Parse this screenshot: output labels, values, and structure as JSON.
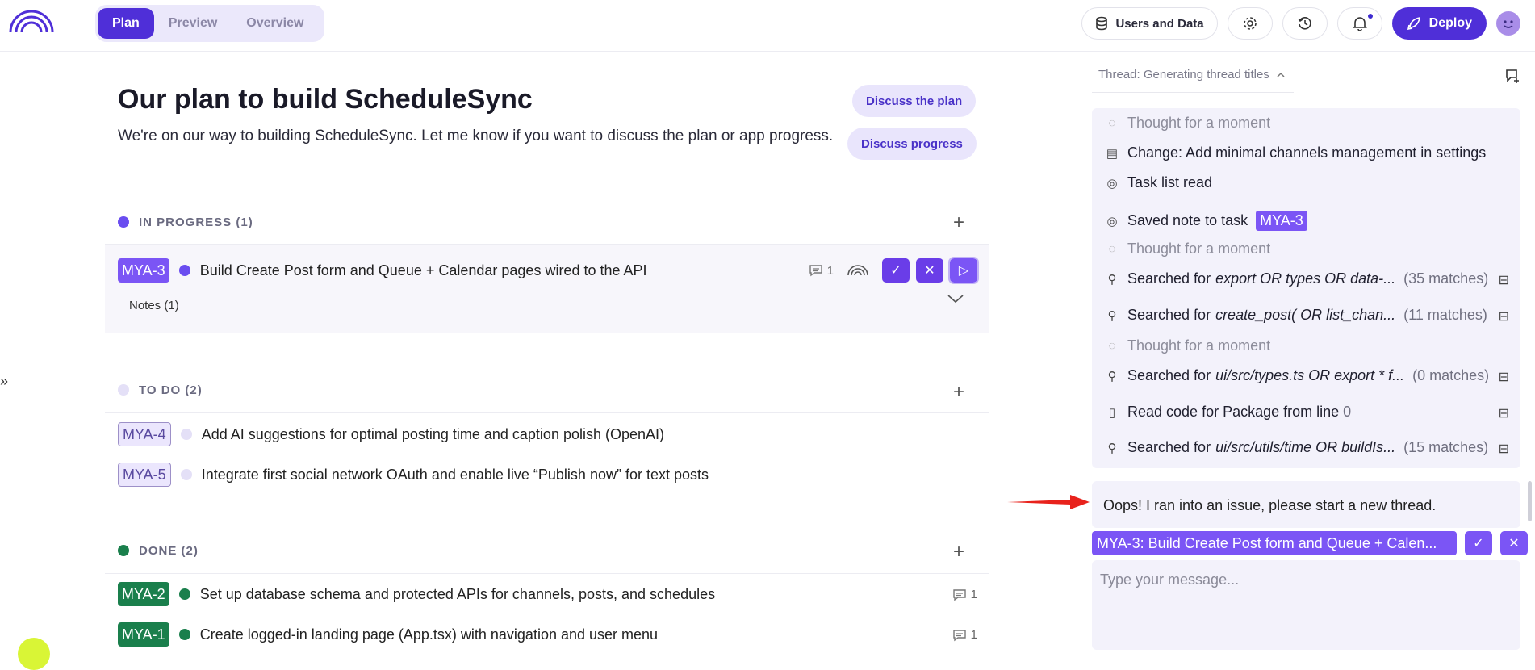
{
  "header": {
    "tabs": [
      {
        "label": "Plan",
        "active": true
      },
      {
        "label": "Preview",
        "active": false
      },
      {
        "label": "Overview",
        "active": false
      }
    ],
    "users_data_label": "Users and Data",
    "deploy_label": "Deploy"
  },
  "plan": {
    "title": "Our plan to build ScheduleSync",
    "subtitle": "We're on our way to building ScheduleSync. Let me know if you want to discuss the plan or app progress.",
    "discuss_plan": "Discuss the plan",
    "discuss_progress": "Discuss progress",
    "sections": {
      "in_progress": {
        "label": "IN PROGRESS (1)",
        "color": "#6a4df0",
        "task": {
          "id": "MYA-3",
          "text": "Build Create Post form and Queue + Calendar pages wired to the API",
          "comments": "1",
          "dot": "#6a4df0"
        },
        "notes": "Notes (1)"
      },
      "todo": {
        "label": "TO DO (2)",
        "color": "#e4e0f7",
        "tasks": [
          {
            "id": "MYA-4",
            "text": "Add AI suggestions for optimal posting time and caption polish (OpenAI)"
          },
          {
            "id": "MYA-5",
            "text": "Integrate first social network OAuth and enable live “Publish now” for text posts"
          }
        ]
      },
      "done": {
        "label": "DONE (2)",
        "color": "#1a7f4c",
        "tasks": [
          {
            "id": "MYA-2",
            "text": "Set up database schema and protected APIs for channels, posts, and schedules",
            "comments": "1"
          },
          {
            "id": "MYA-1",
            "text": "Create logged-in landing page (App.tsx) with navigation and user menu",
            "comments": "1"
          }
        ]
      }
    },
    "collapse_icon": "double-chevron-right-icon"
  },
  "thread": {
    "title": "Thread: Generating thread titles",
    "log": [
      {
        "icon": "chat-bubble-icon",
        "text": "Thought for a moment",
        "dim": true
      },
      {
        "icon": "document-icon",
        "text": "Change: Add minimal channels management in settings"
      },
      {
        "icon": "check-circle-icon",
        "text": "Task list read"
      },
      {
        "icon": "check-circle-icon",
        "text": "Saved note to task",
        "tag": "MYA-3"
      },
      {
        "icon": "chat-bubble-icon",
        "text": "Thought for a moment",
        "dim": true
      },
      {
        "icon": "search-icon",
        "prefix": "Searched for",
        "query": "export OR types OR data-...",
        "count": "(35 matches)"
      },
      {
        "icon": "search-icon",
        "prefix": "Searched for",
        "query": "create_post( OR list_chan...",
        "count": "(11 matches)"
      },
      {
        "icon": "chat-bubble-icon",
        "text": "Thought for a moment",
        "dim": true
      },
      {
        "icon": "search-icon",
        "prefix": "Searched for",
        "query": "ui/src/types.ts OR export * f...",
        "count": "(0 matches)"
      },
      {
        "icon": "book-icon",
        "prefix": "Read code for Package from line",
        "count": "0"
      },
      {
        "icon": "search-icon",
        "prefix": "Searched for",
        "query": "ui/src/utils/time OR buildIs...",
        "count": "(15 matches)"
      }
    ],
    "error": "Oops! I ran into an issue, please start a new thread.",
    "context_tag": "MYA-3: Build Create Post form and Queue + Calen...",
    "message_placeholder": "Type your message..."
  },
  "colors": {
    "accent": "#4f2fd8",
    "tag_purple": "#7b55f5",
    "done_green": "#1a7f4c"
  }
}
